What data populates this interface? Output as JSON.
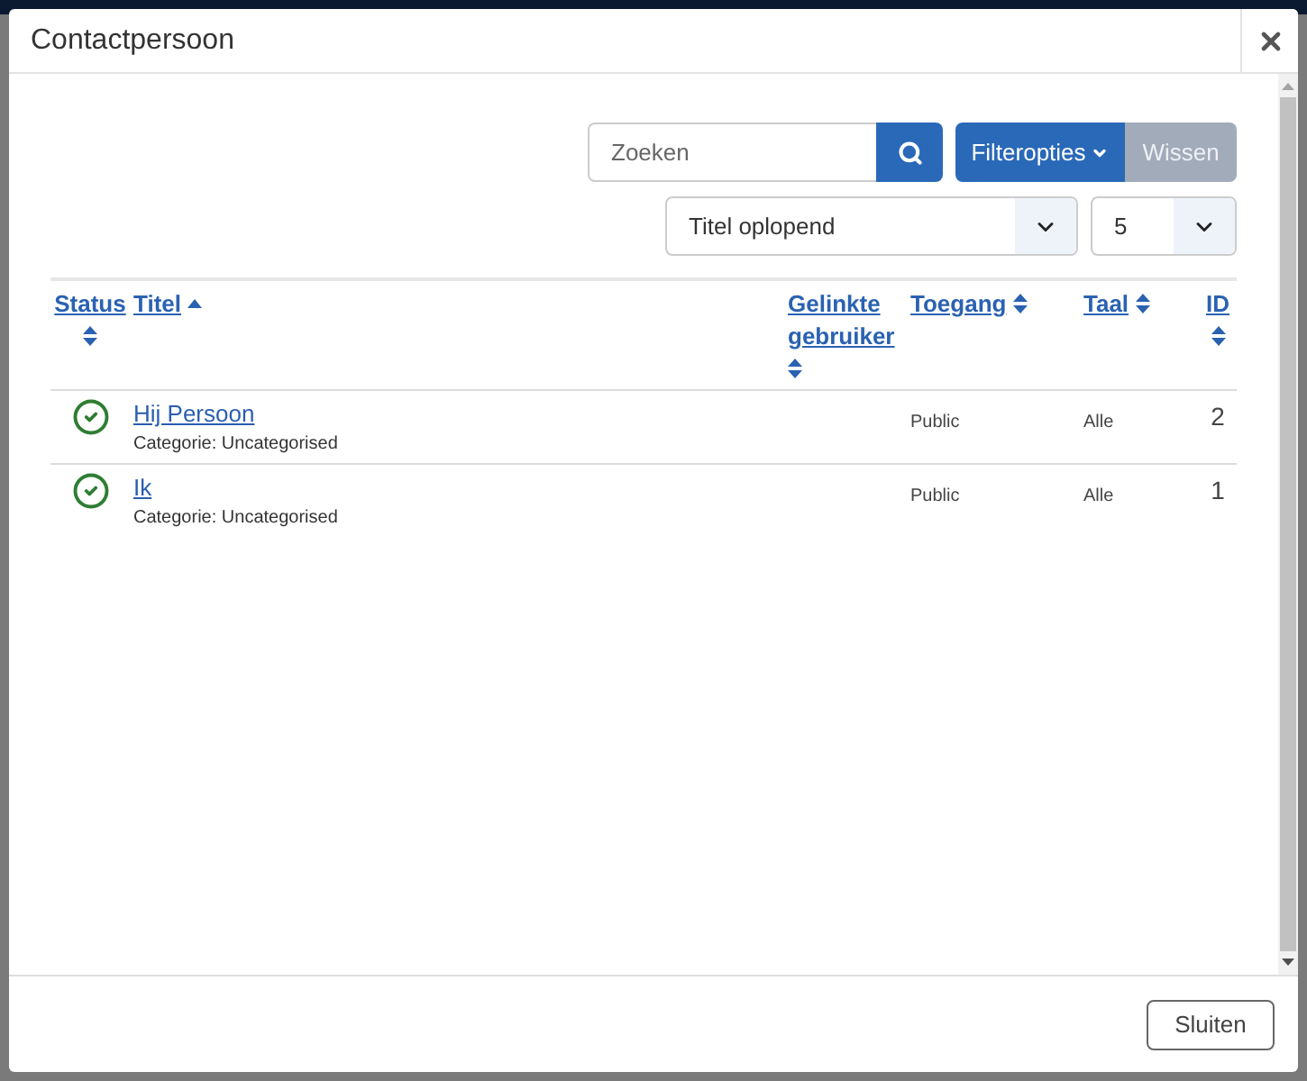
{
  "dialog": {
    "title": "Contactpersoon"
  },
  "toolbar": {
    "search": {
      "placeholder": "Zoeken"
    },
    "filter_button": {
      "label": "Filteropties"
    },
    "clear_button": {
      "label": "Wissen"
    },
    "sort_select": {
      "value": "Titel oplopend"
    },
    "limit_select": {
      "value": "5"
    }
  },
  "table": {
    "columns": [
      {
        "label": "Status",
        "sorted": false
      },
      {
        "label": "Titel",
        "sorted": true
      },
      {
        "label": "Gelinkte gebruiker",
        "sorted": false
      },
      {
        "label": "Toegang",
        "sorted": false
      },
      {
        "label": "Taal",
        "sorted": false
      },
      {
        "label": "ID",
        "sorted": false
      }
    ],
    "rows": [
      {
        "published": true,
        "title": "Hij Persoon",
        "category": "Categorie: Uncategorised",
        "access": "Public",
        "language": "Alle",
        "id": "2"
      },
      {
        "published": true,
        "title": "Ik",
        "category": "Categorie: Uncategorised",
        "access": "Public",
        "language": "Alle",
        "id": "1"
      }
    ]
  },
  "footer": {
    "close_button": "Sluiten"
  }
}
